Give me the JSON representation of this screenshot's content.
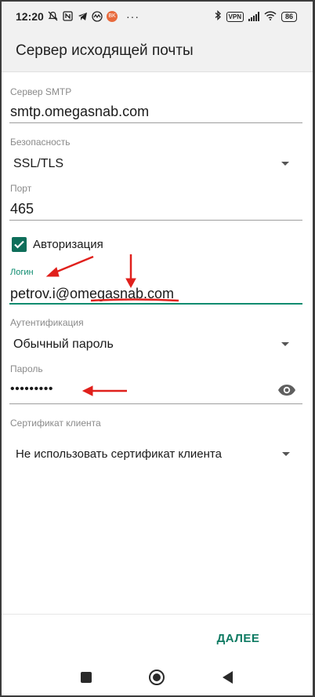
{
  "status_bar": {
    "time": "12:20",
    "vpn": "VPN",
    "battery": "86",
    "more": "···",
    "badge": "BK"
  },
  "app_bar": {
    "title": "Сервер исходящей почты"
  },
  "form": {
    "smtp_server": {
      "label": "Сервер SMTP",
      "value": "smtp.omegasnab.com"
    },
    "security": {
      "label": "Безопасность",
      "value": "SSL/TLS"
    },
    "port": {
      "label": "Порт",
      "value": "465"
    },
    "authorization": {
      "label": "Авторизация",
      "checked": true
    },
    "login": {
      "label": "Логин",
      "value": "petrov.i@omegasnab.com"
    },
    "authentication": {
      "label": "Аутентификация",
      "value": "Обычный пароль"
    },
    "password": {
      "label": "Пароль",
      "value": "•••••••••"
    },
    "client_certificate": {
      "label": "Сертификат клиента",
      "value": "Не использовать сертификат клиента"
    }
  },
  "actions": {
    "next_label": "ДАЛЕЕ"
  },
  "colors": {
    "accent": "#0e8c70",
    "annotation": "#e0201c"
  }
}
